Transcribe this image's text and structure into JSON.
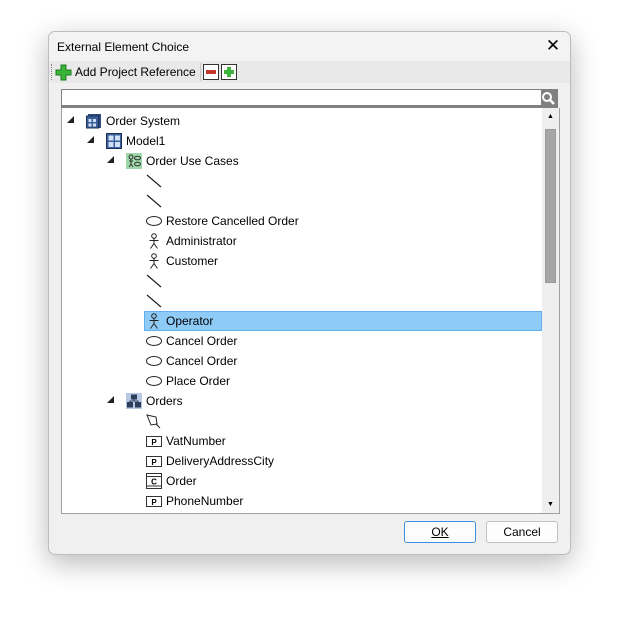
{
  "window": {
    "title": "External Element Choice",
    "close_label": "✕"
  },
  "toolbar": {
    "add_reference_label": "Add Project Reference",
    "collapse_icon": "collapse-all-icon",
    "expand_icon": "expand-all-icon"
  },
  "search": {
    "value": "",
    "placeholder": "",
    "icon": "search-icon"
  },
  "tree": {
    "items": [
      {
        "level": 0,
        "toggle": true,
        "icon": "project",
        "label": "Order System"
      },
      {
        "level": 1,
        "toggle": true,
        "icon": "model",
        "label": "Model1"
      },
      {
        "level": 2,
        "toggle": true,
        "icon": "usecase-package",
        "label": "Order Use Cases"
      },
      {
        "level": 3,
        "icon": "association",
        "label": ""
      },
      {
        "level": 3,
        "icon": "association",
        "label": ""
      },
      {
        "level": 3,
        "icon": "usecase",
        "label": "Restore Cancelled Order"
      },
      {
        "level": 3,
        "icon": "actor",
        "label": "Administrator"
      },
      {
        "level": 3,
        "icon": "actor",
        "label": "Customer"
      },
      {
        "level": 3,
        "icon": "association",
        "label": ""
      },
      {
        "level": 3,
        "icon": "association",
        "label": ""
      },
      {
        "level": 3,
        "icon": "actor",
        "label": "Operator",
        "selected": true
      },
      {
        "level": 3,
        "icon": "usecase",
        "label": "Cancel Order"
      },
      {
        "level": 3,
        "icon": "usecase",
        "label": "Cancel Order"
      },
      {
        "level": 3,
        "icon": "usecase",
        "label": "Place Order"
      },
      {
        "level": 2,
        "toggle": true,
        "icon": "class-package",
        "label": "Orders"
      },
      {
        "level": 3,
        "icon": "note-anchor",
        "label": ""
      },
      {
        "level": 3,
        "icon": "property",
        "label": "VatNumber"
      },
      {
        "level": 3,
        "icon": "property",
        "label": "DeliveryAddressCity"
      },
      {
        "level": 3,
        "icon": "class",
        "label": "Order"
      },
      {
        "level": 3,
        "icon": "property",
        "label": "PhoneNumber"
      }
    ]
  },
  "buttons": {
    "ok": "OK",
    "cancel": "Cancel"
  },
  "colors": {
    "selection": "#8ecbf7",
    "accent": "#3c8ede"
  }
}
